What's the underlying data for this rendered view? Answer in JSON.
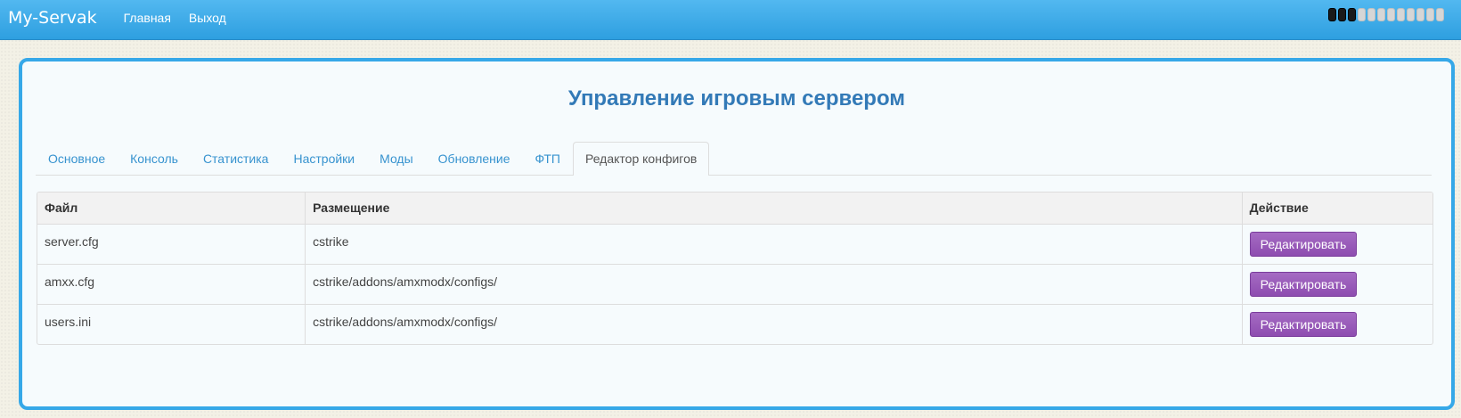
{
  "navbar": {
    "brand": "My-Servak",
    "links": [
      {
        "label": "Главная"
      },
      {
        "label": "Выход"
      }
    ],
    "signal": {
      "bars_total": 12,
      "bars_active": 3
    }
  },
  "page": {
    "title": "Управление игровым сервером"
  },
  "tabs": [
    {
      "label": "Основное",
      "active": false
    },
    {
      "label": "Консоль",
      "active": false
    },
    {
      "label": "Статистика",
      "active": false
    },
    {
      "label": "Настройки",
      "active": false
    },
    {
      "label": "Моды",
      "active": false
    },
    {
      "label": "Обновление",
      "active": false
    },
    {
      "label": "ФТП",
      "active": false
    },
    {
      "label": "Редактор конфигов",
      "active": true
    }
  ],
  "table": {
    "columns": [
      "Файл",
      "Размещение",
      "Действие"
    ],
    "rows": [
      {
        "file": "server.cfg",
        "location": "cstrike",
        "action": "Редактировать"
      },
      {
        "file": "amxx.cfg",
        "location": "cstrike/addons/amxmodx/configs/",
        "action": "Редактировать"
      },
      {
        "file": "users.ini",
        "location": "cstrike/addons/amxmodx/configs/",
        "action": "Редактировать"
      }
    ]
  },
  "colors": {
    "navbar": "#3aa9e8",
    "panel_border": "#36a8e8",
    "title": "#337ab7",
    "tab_link": "#3793cf",
    "button": "#9b59b6"
  }
}
